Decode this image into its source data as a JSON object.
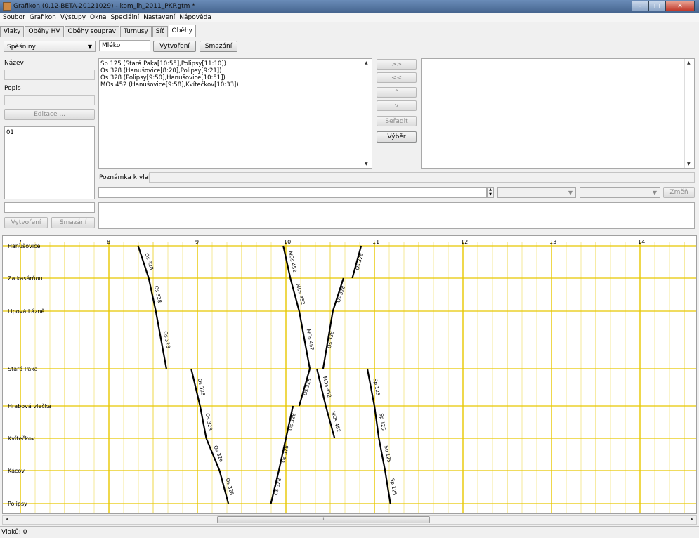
{
  "window": {
    "title": "Grafikon (0.12-BETA-20121029) - kom_lh_2011_PKP.gtm *",
    "min": "–",
    "max": "□",
    "close": "✕"
  },
  "menu": [
    "Soubor",
    "Grafikon",
    "Výstupy",
    "Okna",
    "Speciální",
    "Nastavení",
    "Nápověda"
  ],
  "tabs": [
    "Vlaky",
    "Oběhy HV",
    "Oběhy souprav",
    "Turnusy",
    "Síť",
    "Oběhy"
  ],
  "active_tab": "Oběhy",
  "toolbar": {
    "type_combo": "Spěšniny",
    "name_value": "Mléko",
    "create_label": "Vytvoření",
    "delete_label": "Smazání"
  },
  "left_panel": {
    "name_label": "Název",
    "desc_label": "Popis",
    "edit_label": "Editace ...",
    "list_items": [
      "01"
    ],
    "create_label": "Vytvoření",
    "delete_label": "Smazání"
  },
  "trains_list": [
    "Sp 125 (Stará Paka[10:55],Polipsy[11:10])",
    "Os 328 (Hanušovice[8:20],Polipsy[9:21])",
    "Os 328 (Polipsy[9:50],Hanušovice[10:51])",
    "MOs 452 (Hanušovice[9:58],Kvítečkov[10:33])"
  ],
  "middle_buttons": {
    "add": ">>",
    "remove": "<<",
    "up": "^",
    "down": "v",
    "sort": "Seřadit",
    "select": "Výběr"
  },
  "note": {
    "label": "Poznámka k vlaku:",
    "change_label": "Změň"
  },
  "graph": {
    "hour_labels": [
      "7",
      "8",
      "9",
      "10",
      "11",
      "12",
      "13",
      "14"
    ],
    "stations": [
      "Hanušovice",
      "Za kasárňou",
      "Lipová Lázně",
      "Stará Paka",
      "Hrabová vlečka",
      "Kvítečkov",
      "Kácov",
      "Polipsy"
    ],
    "line_color": "#e8c800",
    "train_color": "#000000",
    "trains": [
      {
        "label": "Os 328",
        "segments": [
          [
            8.33,
            0,
            8.45,
            1
          ],
          [
            8.45,
            1,
            8.53,
            2
          ],
          [
            8.53,
            2,
            8.65,
            3
          ],
          [
            8.93,
            3,
            9.03,
            4
          ],
          [
            9.03,
            4,
            9.1,
            5
          ],
          [
            9.1,
            5,
            9.25,
            6
          ],
          [
            9.25,
            6,
            9.35,
            7
          ]
        ]
      },
      {
        "label": "MOs 452",
        "segments": [
          [
            9.97,
            0,
            10.05,
            1
          ],
          [
            10.05,
            1,
            10.15,
            2
          ],
          [
            10.15,
            2,
            10.27,
            3
          ],
          [
            10.35,
            3,
            10.45,
            4
          ],
          [
            10.45,
            4,
            10.55,
            5
          ]
        ]
      },
      {
        "label": "Os 328",
        "segments": [
          [
            9.83,
            7,
            9.92,
            6
          ],
          [
            9.92,
            6,
            10.0,
            5
          ],
          [
            10.0,
            5,
            10.08,
            4
          ],
          [
            10.15,
            4,
            10.27,
            3
          ],
          [
            10.42,
            3,
            10.53,
            2
          ],
          [
            10.53,
            2,
            10.65,
            1
          ],
          [
            10.75,
            1,
            10.85,
            0
          ]
        ]
      },
      {
        "label": "Sp 125",
        "segments": [
          [
            10.92,
            3,
            11.0,
            4
          ],
          [
            11.0,
            4,
            11.05,
            5
          ],
          [
            11.05,
            5,
            11.12,
            6
          ],
          [
            11.12,
            6,
            11.18,
            7
          ]
        ]
      }
    ]
  },
  "scroll_thumb": "III",
  "scroll_left": "◂",
  "scroll_right": "▸",
  "status": {
    "trains_count": "Vlaků: 0"
  }
}
